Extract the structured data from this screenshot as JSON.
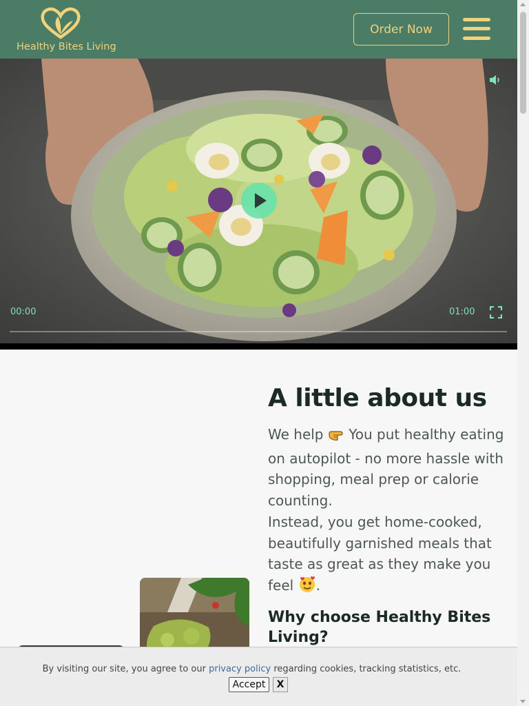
{
  "header": {
    "brand_name": "Healthy Bites Living",
    "logo_icon": "heart-leaf-icon",
    "order_label": "Order Now",
    "menu_icon": "hamburger-menu-icon"
  },
  "video": {
    "current_time": "00:00",
    "duration": "01:00",
    "progress": 0,
    "icons": [
      "play-icon",
      "volume-icon",
      "fullscreen-icon"
    ]
  },
  "about": {
    "title": "A little about us",
    "intro_pre": "We help ",
    "intro_post": " You put healthy eating on autopilot - no more hassle with shopping, meal prep or calorie counting.",
    "body_pre": "Instead, you get home-cooked, beautifully garnished meals that taste as great as they make you feel ",
    "body_post": ".",
    "emoji_1": "pointing-hand-emoji",
    "emoji_2": "smiling-hearts-emoji",
    "why_title": "Why choose Healthy Bites Living?"
  },
  "cookie": {
    "text_pre": "By visiting our site, you agree to our ",
    "link": "privacy policy",
    "text_post": " regarding cookies, tracking statistics, etc.",
    "accept_label": "Accept",
    "close_label": "X"
  },
  "colors": {
    "header_bg": "#4a7c66",
    "accent_gold": "#f2d27a",
    "video_controls": "#7ee2bb",
    "heading": "#1b2a26",
    "body_text": "#4d5752"
  }
}
